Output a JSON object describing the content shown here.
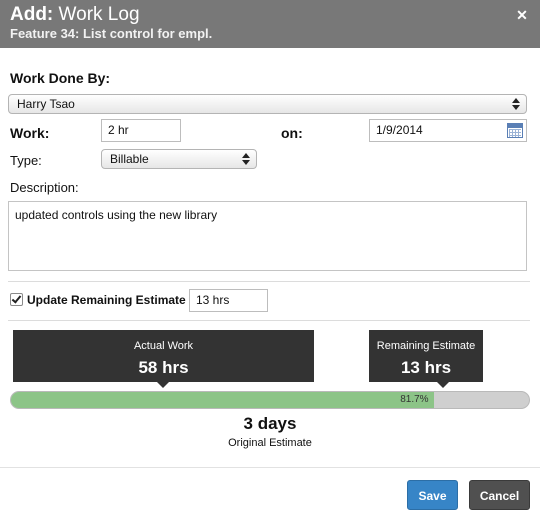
{
  "header": {
    "title_prefix": "Add:",
    "title": "Work Log",
    "subtitle": "Feature 34: List control for empl.",
    "close_icon": "close-icon"
  },
  "form": {
    "work_done_by_label": "Work Done By:",
    "work_done_by_value": "Harry Tsao",
    "work_label": "Work:",
    "work_value": "2 hr",
    "on_label": "on:",
    "date_value": "1/9/2014",
    "type_label": "Type:",
    "type_value": "Billable",
    "description_label": "Description:",
    "description_value": "updated controls using the new library",
    "update_remaining_label": "Update Remaining Estimate",
    "update_remaining_checked": true,
    "remaining_value": "13 hrs"
  },
  "summary": {
    "actual_work_title": "Actual Work",
    "actual_work_value": "58 hrs",
    "remaining_title": "Remaining Estimate",
    "remaining_value": "13 hrs",
    "progress_percent_label": "81.7%",
    "progress_fraction": 0.817,
    "original_estimate_value": "3 days",
    "original_estimate_label": "Original Estimate"
  },
  "footer": {
    "save_label": "Save",
    "cancel_label": "Cancel"
  },
  "colors": {
    "header_bg": "#787878",
    "progress_fill": "#8cc487",
    "save_button": "#3785c7",
    "cancel_button": "#505050",
    "callout_bg": "#333333"
  }
}
